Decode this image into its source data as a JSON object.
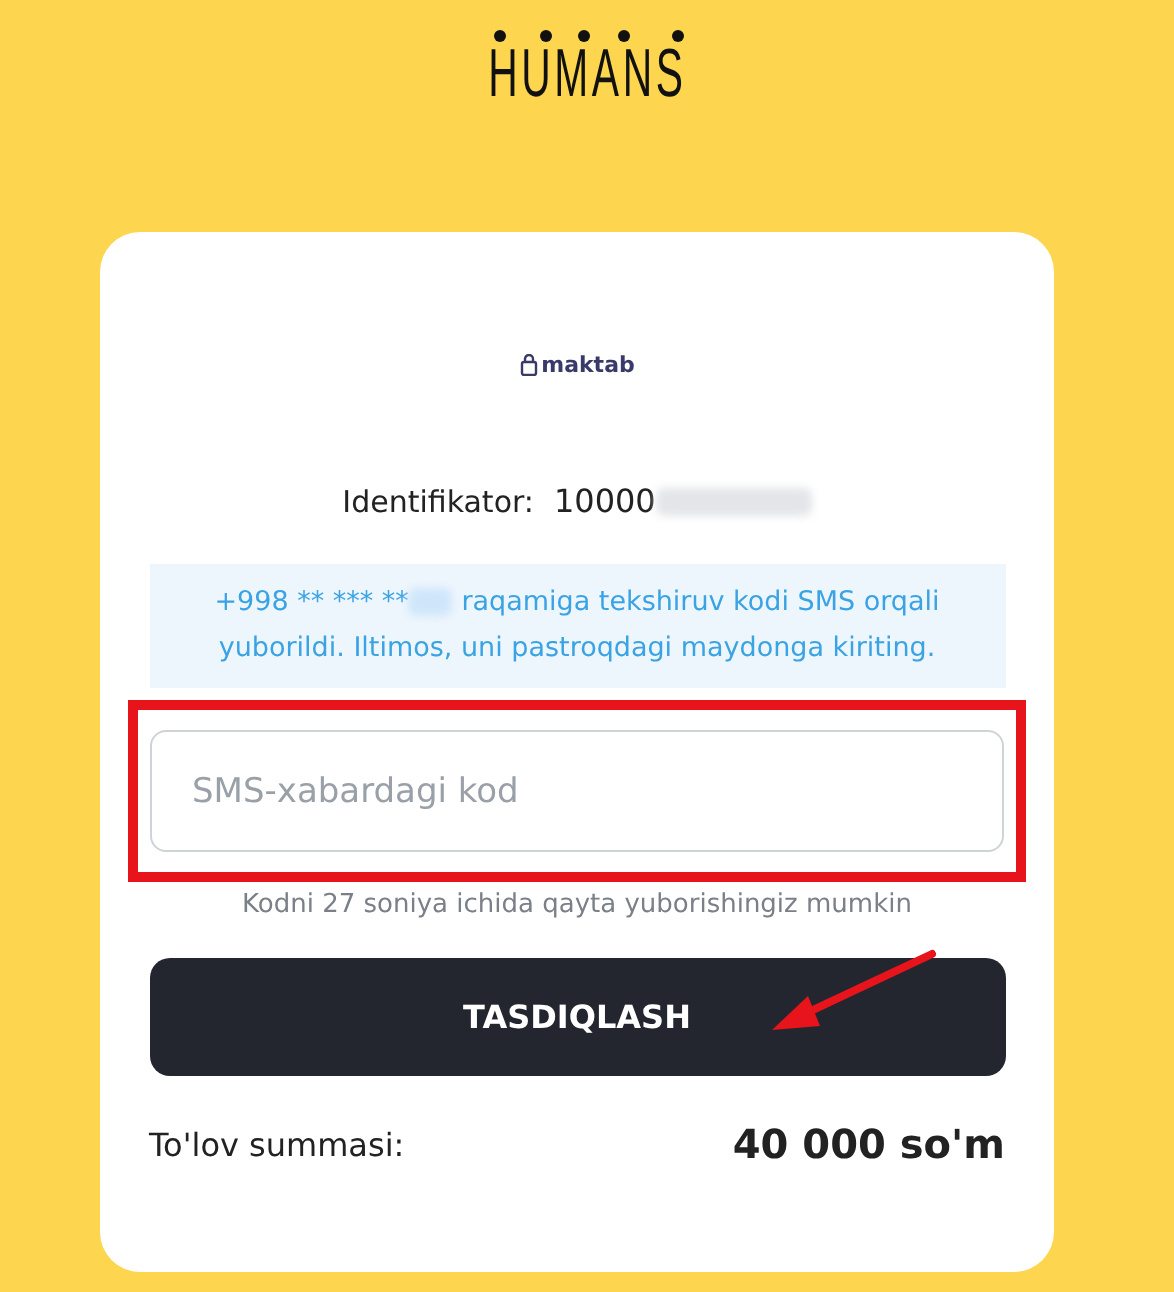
{
  "logo": "HUMANS",
  "school_logo": "maktab",
  "identifier": {
    "label": "Identifikator:",
    "value": "10000"
  },
  "info": {
    "prefix": "+998 ** *** **",
    "text": "raqamiga tekshiruv kodi SMS orqali yuborildi. Iltimos, uni pastroqdagi maydonga kiriting."
  },
  "code_field": {
    "placeholder": "SMS-xabardagi kod"
  },
  "resend_hint": "Kodni 27 soniya ichida qayta yuborishingiz mumkin",
  "confirm_button": "TASDIQLASH",
  "total": {
    "label": "To'lov summasi:",
    "value": "40 000 so'm"
  }
}
